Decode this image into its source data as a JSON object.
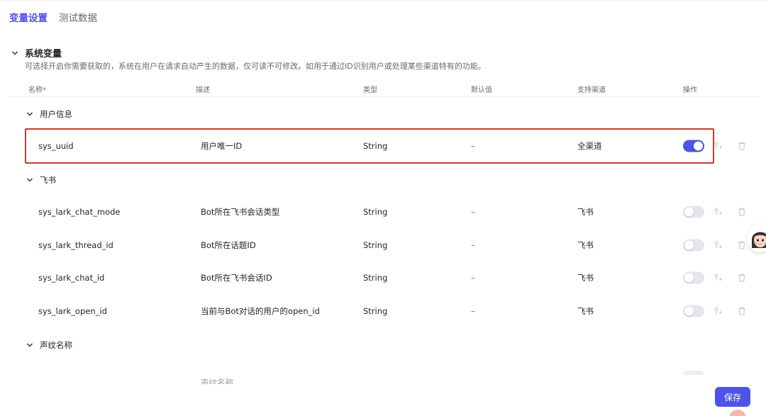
{
  "tabs": [
    {
      "label": "变量设置",
      "active": true
    },
    {
      "label": "测试数据",
      "active": false
    }
  ],
  "section": {
    "title": "系统变量",
    "description": "可选择开启你需要获取的，系统在用户在请求自动产生的数据，仅可读不可修改。如用于通过ID识别用户或处理某些渠道特有的功能。"
  },
  "columns": {
    "name": "名称",
    "required_mark": "*",
    "description": "描述",
    "type": "类型",
    "default": "默认值",
    "channel": "支持渠道",
    "actions": "操作"
  },
  "groups": [
    {
      "label": "用户信息",
      "rows": [
        {
          "name": "sys_uuid",
          "description": "用户唯一ID",
          "type": "String",
          "default": "–",
          "channel": "全渠道",
          "enabled": true
        }
      ]
    },
    {
      "label": "飞书",
      "rows": [
        {
          "name": "sys_lark_chat_mode",
          "description": "Bot所在飞书会话类型",
          "type": "String",
          "default": "–",
          "channel": "飞书",
          "enabled": false
        },
        {
          "name": "sys_lark_thread_id",
          "description": "Bot所在话题ID",
          "type": "String",
          "default": "–",
          "channel": "飞书",
          "enabled": false
        },
        {
          "name": "sys_lark_chat_id",
          "description": "Bot所在飞书会话ID",
          "type": "String",
          "default": "–",
          "channel": "飞书",
          "enabled": false
        },
        {
          "name": "sys_lark_open_id",
          "description": "当前与Bot对话的用户的open_id",
          "type": "String",
          "default": "–",
          "channel": "飞书",
          "enabled": false
        }
      ]
    },
    {
      "label": "声纹名称",
      "rows": [
        {
          "description": "声纹名称"
        }
      ]
    }
  ],
  "save_label": "保存",
  "colors": {
    "accent": "#4d53e8",
    "highlight_border": "#c93a2f",
    "required": "#f54a45"
  }
}
